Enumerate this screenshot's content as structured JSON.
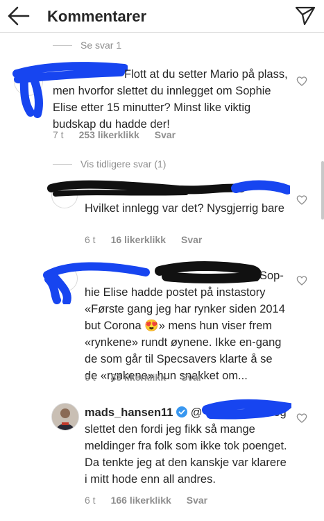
{
  "header": {
    "title": "Kommentarer"
  },
  "thread": {
    "see_replies": "Se svar 1",
    "comment1": {
      "text": "Flott at du setter Mario på plass, men hvorfor slettet du innlegget om Sophie Elise etter 15 minutter? Minst like viktig budskap du hadde der!",
      "time": "7 t",
      "likes": "253 likerklikk",
      "reply": "Svar"
    },
    "previous_replies": "Vis tidligere svar (1)",
    "reply1": {
      "text": "Hvilket innlegg var det? Nysgjerrig bare",
      "time": "6 t",
      "likes": "16 likerklikk",
      "reply": "Svar"
    },
    "reply2": {
      "mention_tail": "Sop-",
      "text": "hie Elise hadde postet på instastory «Første gang jeg har rynker siden 2014 but Corona 😍» mens hun viser frem «rynkene» rundt øynene. Ikke en-gang de som går til Specsavers klarte å se de «rynkene» hun snakket om...",
      "time": "6 t",
      "likes": "83 likerklikk",
      "reply": "Svar"
    },
    "reply3": {
      "username": "mads_hansen11",
      "mention_prefix": "@",
      "text": "Jeg slettet den fordi jeg fikk så mange meldinger fra folk som ikke tok poenget. Da tenkte jeg at den kanskje var klarere i mitt hode enn all andres.",
      "time": "6 t",
      "likes": "166 likerklikk",
      "reply": "Svar"
    }
  },
  "colors": {
    "redaction_blue": "#1745f0",
    "redaction_black": "#111111",
    "verified": "#3897f0"
  }
}
